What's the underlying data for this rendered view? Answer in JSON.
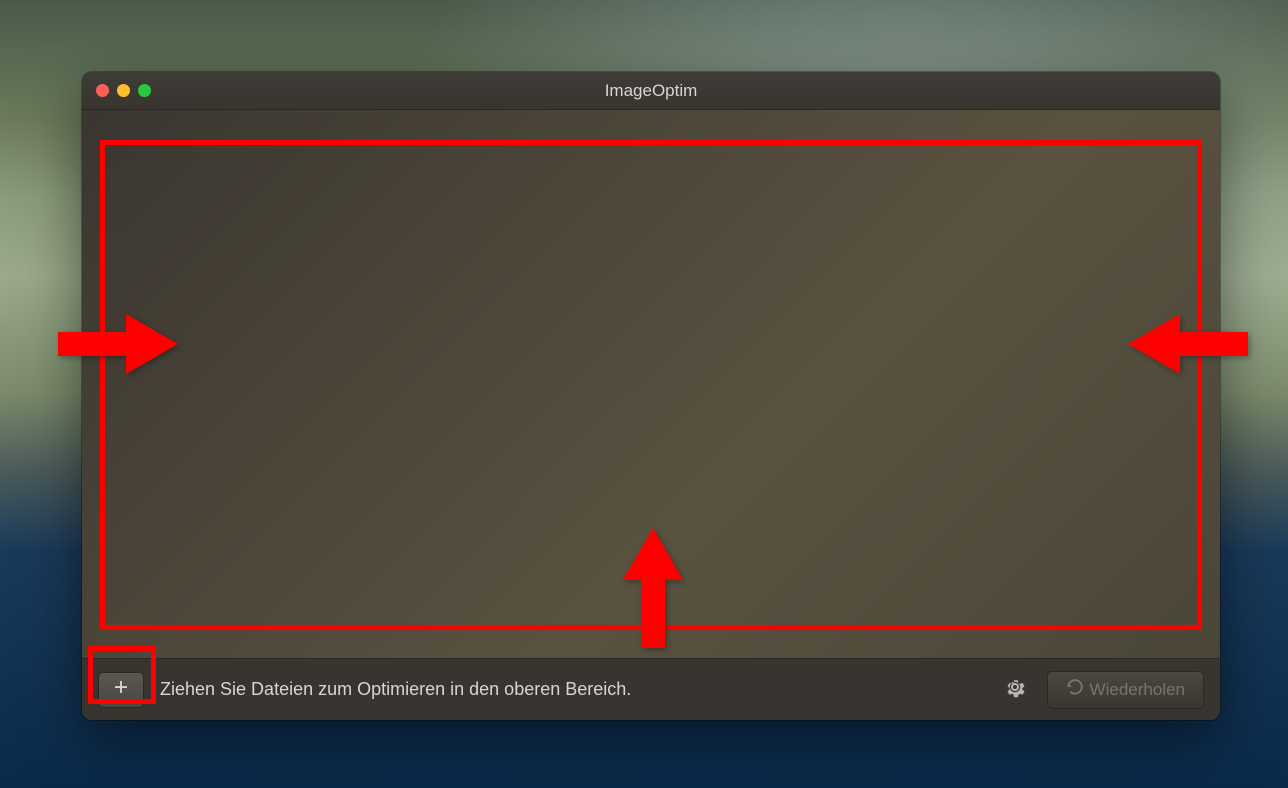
{
  "window": {
    "title": "ImageOptim"
  },
  "toolbar": {
    "add_icon": "plus-icon",
    "status_text": "Ziehen Sie Dateien zum Optimieren in den oberen Bereich.",
    "settings_icon": "gear-icon",
    "repeat_label": "Wiederholen",
    "repeat_icon": "refresh-icon"
  },
  "annotations": {
    "highlight_color": "#ff0000"
  }
}
